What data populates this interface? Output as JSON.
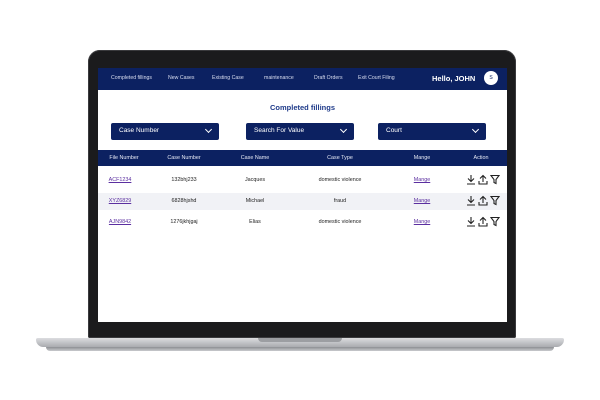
{
  "nav": {
    "items": [
      "Completed fillings",
      "New Cases",
      "Existing Case",
      "maintenance",
      "Draft Orders",
      "Exit Court Filing"
    ],
    "greeting": "Hello, JOHN",
    "avatar_initial": "S"
  },
  "page": {
    "title": "Completed fillings"
  },
  "filters": [
    {
      "selected": "Case Number"
    },
    {
      "selected": "Search For Value"
    },
    {
      "selected": "Court"
    }
  ],
  "table": {
    "headers": [
      "File Number",
      "Case Number",
      "Case Name",
      "Case Type",
      "Mange",
      "Action"
    ],
    "rows": [
      {
        "file_number": "ACF1234",
        "case_number": "132bhj233",
        "case_name": "Jacques",
        "case_type": "domestic violence",
        "manage": "Mange"
      },
      {
        "file_number": "XYZ6829",
        "case_number": "6828hjshd",
        "case_name": "Michael",
        "case_type": "fraud",
        "manage": "Mange"
      },
      {
        "file_number": "AJN9842",
        "case_number": "1276jkhjgaj",
        "case_name": "Elias",
        "case_type": "domestic violence",
        "manage": "Mange"
      }
    ]
  },
  "colors": {
    "navy": "#0c2161",
    "title": "#1f3b8a",
    "link": "#5b2fa0"
  },
  "icons": [
    "download-icon",
    "upload-icon",
    "filter-icon"
  ]
}
